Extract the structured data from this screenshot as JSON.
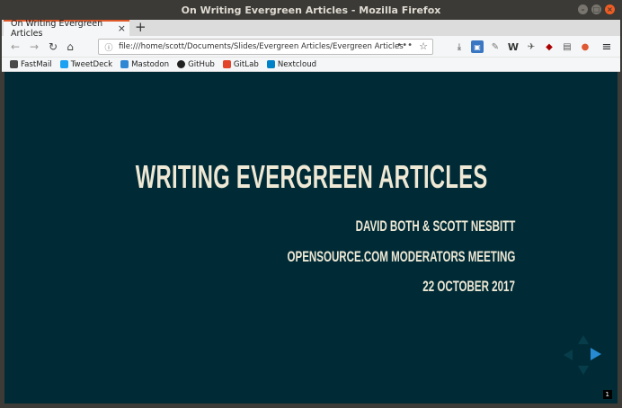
{
  "window": {
    "title": "On Writing Evergreen Articles - Mozilla Firefox",
    "controls": {
      "minimize": "–",
      "maximize": "□",
      "close": "×"
    }
  },
  "tabs": [
    {
      "label": "On Writing Evergreen Articles",
      "close": "×"
    }
  ],
  "new_tab": "+",
  "toolbar": {
    "back": "←",
    "forward": "→",
    "reload": "↻",
    "home": "⌂",
    "url_info": "ⓘ",
    "url": "file:///home/scott/Documents/Slides/Evergreen Articles/Evergreen Articles Talk/On W",
    "page_actions": "•••",
    "bookmark_star": "☆",
    "extensions": [
      {
        "name": "library-icon",
        "glyph": "⤓"
      },
      {
        "name": "pocket-icon",
        "glyph": "▣"
      },
      {
        "name": "tools-icon",
        "glyph": "✎"
      },
      {
        "name": "w-extension-icon",
        "glyph": "W"
      },
      {
        "name": "bird-extension-icon",
        "glyph": "✈"
      },
      {
        "name": "ublock-icon",
        "glyph": "◆"
      },
      {
        "name": "reader-icon",
        "glyph": "▤"
      },
      {
        "name": "duckduckgo-icon",
        "glyph": "●"
      }
    ],
    "menu": "≡"
  },
  "bookmarks": [
    {
      "label": "FastMail",
      "icon": "fastmail-icon",
      "color": "#4a4a4a"
    },
    {
      "label": "TweetDeck",
      "icon": "tweetdeck-icon",
      "color": "#1da1f2"
    },
    {
      "label": "Mastodon",
      "icon": "mastodon-icon",
      "color": "#3088d4"
    },
    {
      "label": "GitHub",
      "icon": "github-icon",
      "color": "#222222"
    },
    {
      "label": "GitLab",
      "icon": "gitlab-icon",
      "color": "#e24329"
    },
    {
      "label": "Nextcloud",
      "icon": "nextcloud-icon",
      "color": "#0082c9"
    }
  ],
  "slide": {
    "title": "WRITING EVERGREEN ARTICLES",
    "authors": "DAVID BOTH & SCOTT NESBITT",
    "event": "OPENSOURCE.COM MODERATORS MEETING",
    "date": "22 OCTOBER 2017",
    "page_number": "1",
    "background": "#002b36",
    "text_color": "#eee8d5",
    "accent": "#268bd2"
  }
}
